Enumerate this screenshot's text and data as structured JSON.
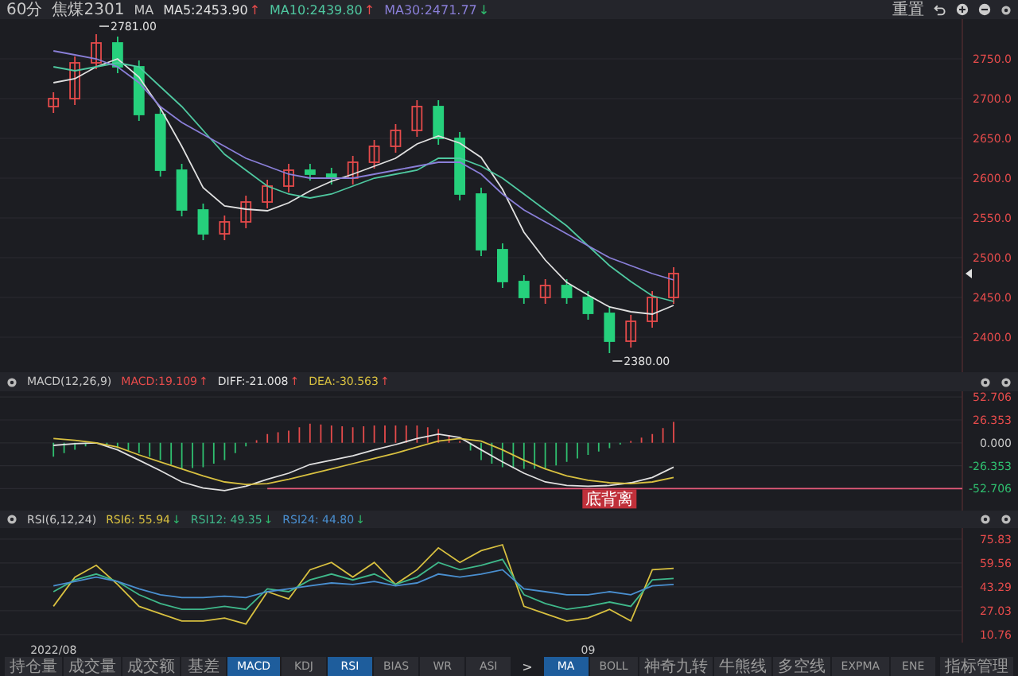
{
  "toolbar": {
    "period": "60分",
    "symbol": "焦煤2301",
    "indicator": "MA",
    "values": [
      {
        "text": "MA5:2453.90",
        "arrow": "↑",
        "rising": true,
        "color": "#e0e0e0"
      },
      {
        "text": "MA10:2439.80",
        "arrow": "↑",
        "rising": true,
        "color": "#4fc8a0"
      },
      {
        "text": "MA30:2471.77",
        "arrow": "↓",
        "rising": false,
        "color": "#8a7fd8"
      }
    ],
    "reset": "重置"
  },
  "main_chart": {
    "chart_data": {
      "type": "candlestick",
      "grid": true,
      "ylim": [
        2356,
        2800
      ],
      "categories": [
        null,
        null,
        null,
        null,
        null,
        null,
        null,
        null,
        null,
        null,
        null,
        null,
        null,
        null,
        null,
        null,
        null,
        null,
        null,
        null,
        null,
        null,
        null,
        null,
        null,
        null,
        null,
        null,
        null,
        null,
        null,
        null,
        null,
        null,
        null,
        null,
        null,
        null,
        null,
        null,
        null,
        null,
        null,
        null,
        null
      ],
      "yticks": [
        {
          "value": 2750,
          "label": "2750.0"
        },
        {
          "value": 2700,
          "label": "2700.0"
        },
        {
          "value": 2650,
          "label": "2650.0"
        },
        {
          "value": 2600,
          "label": "2600.0"
        },
        {
          "value": 2550,
          "label": "2550.0"
        },
        {
          "value": 2500,
          "label": "2500.0"
        },
        {
          "value": 2450,
          "label": "2450.0"
        },
        {
          "value": 2400,
          "label": "2400.0"
        }
      ],
      "ohlc": [
        null,
        null,
        [
          2690,
          2708,
          2682,
          2700
        ],
        [
          2700,
          2753,
          2692,
          2745
        ],
        [
          2745,
          2781,
          2737,
          2770
        ],
        [
          2770,
          2778,
          2732,
          2740
        ],
        [
          2740,
          2748,
          2672,
          2680
        ],
        [
          2680,
          2688,
          2602,
          2610
        ],
        [
          2610,
          2618,
          2552,
          2560
        ],
        [
          2560,
          2568,
          2522,
          2530
        ],
        [
          2530,
          2553,
          2522,
          2545
        ],
        [
          2545,
          2578,
          2537,
          2570
        ],
        [
          2570,
          2598,
          2562,
          2590
        ],
        [
          2590,
          2618,
          2582,
          2610
        ],
        [
          2610,
          2618,
          2597,
          2605
        ],
        [
          2605,
          2613,
          2592,
          2600
        ],
        [
          2600,
          2628,
          2592,
          2620
        ],
        [
          2620,
          2648,
          2612,
          2640
        ],
        [
          2640,
          2668,
          2632,
          2660
        ],
        [
          2660,
          2698,
          2652,
          2690
        ],
        [
          2690,
          2698,
          2642,
          2650
        ],
        [
          2650,
          2658,
          2572,
          2580
        ],
        [
          2580,
          2588,
          2502,
          2510
        ],
        [
          2510,
          2518,
          2462,
          2470
        ],
        [
          2470,
          2478,
          2442,
          2450
        ],
        [
          2450,
          2473,
          2442,
          2465
        ],
        [
          2465,
          2473,
          2442,
          2450
        ],
        [
          2450,
          2458,
          2422,
          2430
        ],
        [
          2430,
          2438,
          2380,
          2395
        ],
        [
          2395,
          2428,
          2387,
          2420
        ],
        [
          2420,
          2458,
          2412,
          2450
        ],
        [
          2450,
          2488,
          2442,
          2480
        ],
        null,
        null,
        null,
        null,
        null,
        null,
        null,
        null,
        null,
        null,
        null,
        null,
        null
      ],
      "series": [
        {
          "type": "line",
          "color": "#e0e0e0",
          "values": [
            null,
            null,
            2720,
            2725,
            2740,
            2750,
            2727,
            2688,
            2640,
            2588,
            2565,
            2561,
            2559,
            2569,
            2584,
            2596,
            2605,
            2615,
            2625,
            2643,
            2653,
            2644,
            2626,
            2586,
            2532,
            2497,
            2469,
            2453,
            2438,
            2432,
            2429,
            2440,
            null,
            null,
            null,
            null,
            null,
            null,
            null,
            null,
            null,
            null,
            null,
            null,
            null
          ]
        },
        {
          "type": "line",
          "color": "#4fc8a0",
          "values": [
            null,
            null,
            2740,
            2735,
            2740,
            2745,
            2740,
            2715,
            2690,
            2660,
            2630,
            2610,
            2590,
            2580,
            2575,
            2580,
            2590,
            2600,
            2605,
            2610,
            2625,
            2625,
            2615,
            2600,
            2580,
            2560,
            2540,
            2515,
            2490,
            2470,
            2452,
            2445,
            null,
            null,
            null,
            null,
            null,
            null,
            null,
            null,
            null,
            null,
            null,
            null,
            null
          ]
        },
        {
          "type": "line",
          "color": "#8a7fd8",
          "values": [
            null,
            null,
            2760,
            2755,
            2750,
            2740,
            2720,
            2690,
            2670,
            2655,
            2640,
            2625,
            2615,
            2605,
            2600,
            2600,
            2600,
            2605,
            2610,
            2615,
            2620,
            2620,
            2605,
            2580,
            2560,
            2545,
            2530,
            2515,
            2500,
            2490,
            2480,
            2472,
            null,
            null,
            null,
            null,
            null,
            null,
            null,
            null,
            null,
            null,
            null,
            null,
            null
          ]
        }
      ],
      "annotations": [
        "2781.00",
        "2380.00"
      ]
    }
  },
  "macd": {
    "title": "MACD(12,26,9)",
    "values": [
      {
        "text": "MACD:19.109",
        "arrow": "↑",
        "rising": true,
        "color": "#e64b4b"
      },
      {
        "text": "DIFF:-21.008",
        "arrow": "↑",
        "rising": true,
        "color": "#e0e0e0"
      },
      {
        "text": "DEA:-30.563",
        "arrow": "↑",
        "rising": true,
        "color": "#d8c040"
      }
    ],
    "chart_data": {
      "type": "line",
      "grid": true,
      "ylim": [
        -78,
        59.3
      ],
      "categories": [
        null,
        null,
        null,
        null,
        null,
        null,
        null,
        null,
        null,
        null,
        null,
        null,
        null,
        null,
        null,
        null,
        null,
        null,
        null,
        null,
        null,
        null,
        null,
        null,
        null,
        null,
        null,
        null,
        null,
        null,
        null,
        null,
        null,
        null,
        null,
        null,
        null,
        null,
        null,
        null,
        null,
        null,
        null,
        null,
        null
      ],
      "yticks": [
        {
          "value": 52.706,
          "label": "52.706"
        },
        {
          "value": 26.353,
          "label": "26.353"
        },
        {
          "value": 0,
          "label": "0.000"
        },
        {
          "value": -26.353,
          "label": "-26.353"
        },
        {
          "value": -52.706,
          "label": "-52.706"
        }
      ],
      "series": [
        {
          "color": "#e0e0e0",
          "values": [
            null,
            null,
            -3,
            -1,
            0,
            -8,
            -20,
            -32,
            -45,
            -52,
            -55,
            -50,
            -42,
            -35,
            -25,
            -20,
            -15,
            -8,
            -2,
            5,
            10,
            6,
            -8,
            -22,
            -35,
            -45,
            -49,
            -50,
            -49,
            -46,
            -40,
            -28,
            null,
            null,
            null,
            null,
            null,
            null,
            null,
            null,
            null,
            null,
            null,
            null,
            null
          ]
        },
        {
          "color": "#d8c040",
          "values": [
            null,
            null,
            5,
            3,
            0,
            -5,
            -14,
            -22,
            -30,
            -38,
            -45,
            -48,
            -47,
            -42,
            -36,
            -30,
            -24,
            -18,
            -12,
            -5,
            2,
            5,
            2,
            -8,
            -20,
            -30,
            -38,
            -43,
            -46,
            -47,
            -45,
            -40,
            null,
            null,
            null,
            null,
            null,
            null,
            null,
            null,
            null,
            null,
            null,
            null,
            null
          ]
        }
      ],
      "ref_lines": [
        {
          "axis": "y",
          "value": -52.706
        }
      ],
      "annotations": [
        "底背离"
      ]
    }
  },
  "rsi": {
    "title": "RSI(6,12,24)",
    "values": [
      {
        "text": "RSI6: 55.94",
        "arrow": "↓",
        "rising": false,
        "color": "#d8c040"
      },
      {
        "text": "RSI12: 49.35",
        "arrow": "↓",
        "rising": false,
        "color": "#3fb88a"
      },
      {
        "text": "RSI24: 44.80",
        "arrow": "↓",
        "rising": false,
        "color": "#4a8fd0"
      }
    ],
    "chart_data": {
      "type": "line",
      "grid": true,
      "ylim": [
        5.3,
        83.4
      ],
      "categories": [
        null,
        null,
        "2022/08",
        null,
        null,
        null,
        null,
        null,
        null,
        null,
        null,
        null,
        null,
        null,
        null,
        null,
        null,
        null,
        null,
        null,
        null,
        null,
        null,
        null,
        null,
        null,
        null,
        "09",
        null,
        null,
        null,
        null,
        null,
        null,
        null,
        null,
        null,
        null,
        null,
        null,
        null,
        null,
        null,
        null,
        null
      ],
      "yticks": [
        {
          "value": 75.83,
          "label": "75.83"
        },
        {
          "value": 59.56,
          "label": "59.56"
        },
        {
          "value": 43.29,
          "label": "43.29"
        },
        {
          "value": 27.03,
          "label": "27.03"
        },
        {
          "value": 10.76,
          "label": "10.76"
        }
      ],
      "series": [
        {
          "color": "#d8c040",
          "values": [
            null,
            null,
            30,
            50,
            58,
            45,
            30,
            25,
            20,
            20,
            22,
            18,
            40,
            35,
            55,
            60,
            50,
            60,
            45,
            55,
            70,
            60,
            68,
            72,
            30,
            25,
            20,
            22,
            28,
            20,
            55,
            56,
            null,
            null,
            null,
            null,
            null,
            null,
            null,
            null,
            null,
            null,
            null,
            null,
            null
          ]
        },
        {
          "color": "#3fb88a",
          "values": [
            null,
            null,
            40,
            48,
            52,
            47,
            38,
            32,
            28,
            28,
            30,
            28,
            42,
            40,
            48,
            52,
            48,
            52,
            45,
            50,
            60,
            55,
            58,
            62,
            38,
            32,
            28,
            30,
            33,
            30,
            48,
            49,
            null,
            null,
            null,
            null,
            null,
            null,
            null,
            null,
            null,
            null,
            null,
            null,
            null
          ]
        },
        {
          "color": "#4a8fd0",
          "values": [
            null,
            null,
            44,
            47,
            50,
            47,
            42,
            38,
            36,
            36,
            37,
            36,
            40,
            42,
            44,
            46,
            45,
            47,
            44,
            46,
            52,
            50,
            52,
            55,
            42,
            40,
            38,
            38,
            40,
            38,
            44,
            45,
            null,
            null,
            null,
            null,
            null,
            null,
            null,
            null,
            null,
            null,
            null,
            null,
            null
          ]
        }
      ]
    }
  },
  "indicator_tabs": [
    {
      "label": "持仓量",
      "selected": false
    },
    {
      "label": "成交量",
      "selected": false
    },
    {
      "label": "成交额",
      "selected": false
    },
    {
      "label": "基差",
      "selected": false
    },
    {
      "label": "MACD",
      "selected": true
    },
    {
      "label": "KDJ",
      "selected": false
    },
    {
      "label": "RSI",
      "selected": true
    },
    {
      "label": "BIAS",
      "selected": false
    },
    {
      "label": "WR",
      "selected": false
    },
    {
      "label": "ASI",
      "selected": false
    }
  ],
  "more_button": ">",
  "overlay_tabs": [
    {
      "label": "MA",
      "selected": true
    },
    {
      "label": "BOLL",
      "selected": false
    },
    {
      "label": "神奇九转",
      "selected": false
    },
    {
      "label": "牛熊线",
      "selected": false
    },
    {
      "label": "多空线",
      "selected": false
    },
    {
      "label": "EXPMA",
      "selected": false
    },
    {
      "label": "ENE",
      "selected": false
    }
  ],
  "manage_button": "指标管理"
}
